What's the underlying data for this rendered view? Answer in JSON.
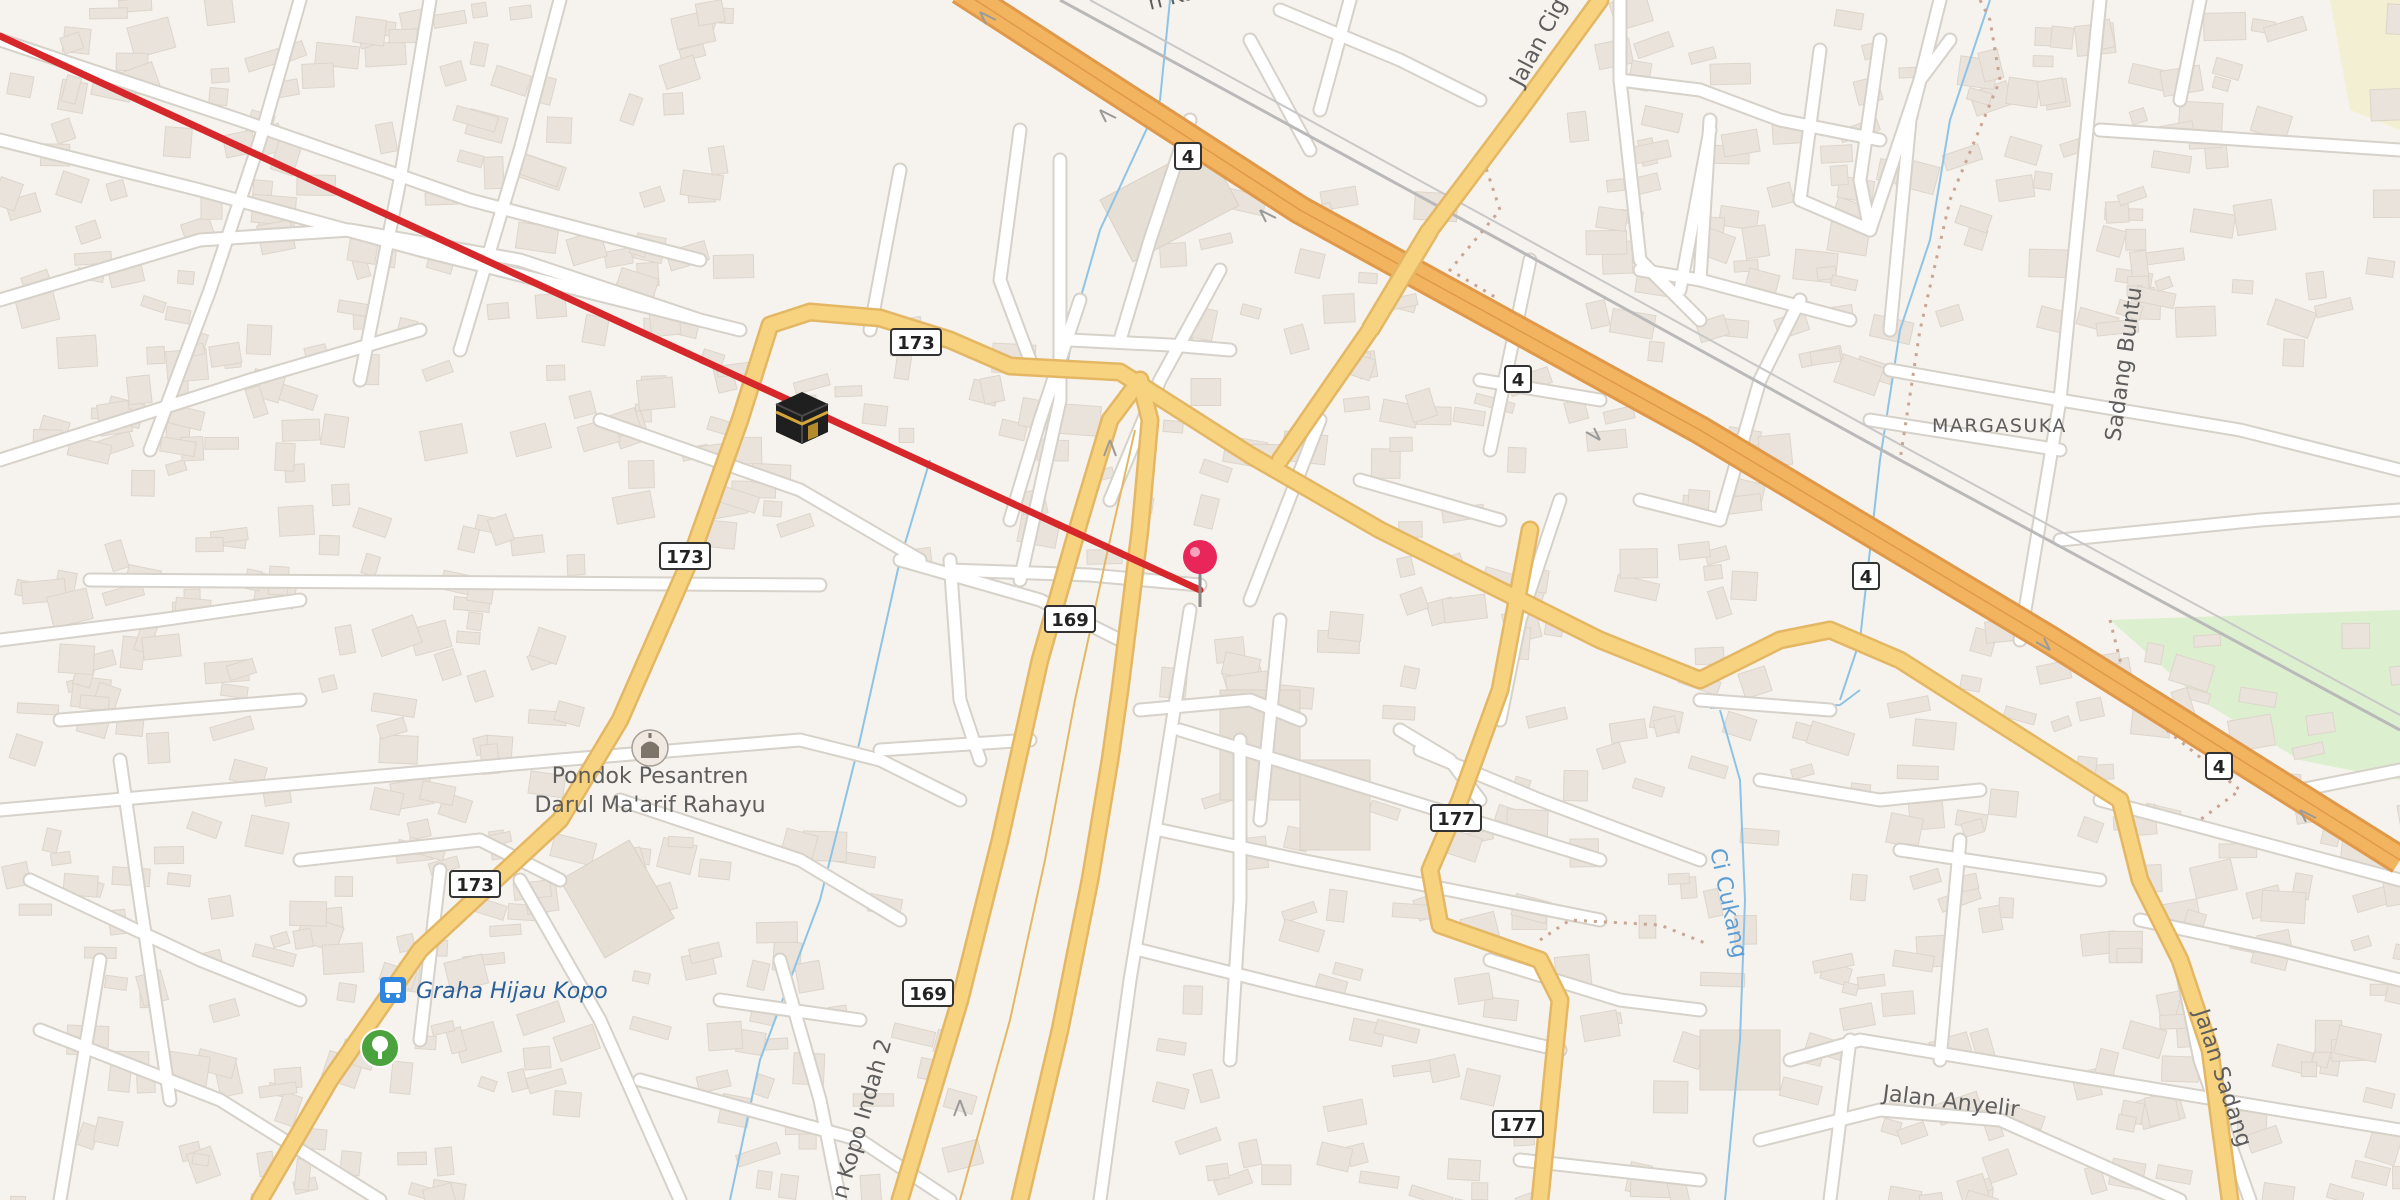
{
  "map": {
    "route_shields": [
      {
        "id": "s4a",
        "text": "4"
      },
      {
        "id": "s4b",
        "text": "4"
      },
      {
        "id": "s4c",
        "text": "4"
      },
      {
        "id": "s4d",
        "text": "4"
      },
      {
        "id": "s173a",
        "text": "173"
      },
      {
        "id": "s173b",
        "text": "173"
      },
      {
        "id": "s173c",
        "text": "173"
      },
      {
        "id": "s169a",
        "text": "169"
      },
      {
        "id": "s169b",
        "text": "169"
      },
      {
        "id": "s177a",
        "text": "177"
      },
      {
        "id": "s177b",
        "text": "177"
      }
    ],
    "street_labels": {
      "jalan_cig": "Jalan Cig",
      "kawinastri": "n Kawinastri",
      "sadang_buntu": "Sadang Buntu",
      "margasuka": "MARGASUKA",
      "kopo_indah": "n Kopo Indah 2",
      "cukang": "Ci Cukang",
      "jalan_anyelir": "Jalan Anyelir",
      "jalan_sadang": "Jalan Sadang"
    },
    "pois": {
      "pesantren_line1": "Pondok Pesantren",
      "pesantren_line2": "Darul Ma'arif Rahayu",
      "bus_stop": "Graha Hijau Kopo"
    },
    "icons": [
      "kaaba-icon",
      "map-pin-icon",
      "mosque-icon",
      "bus-stop-icon",
      "park-tree-icon"
    ],
    "colors": {
      "background": "#f6f3ee",
      "building": "#e9e3db",
      "minor_road": "#ffffff",
      "secondary_road": "#f8d37f",
      "motorway": "#f2b45e",
      "qibla_line": "#d6282b",
      "water": "#8ec3e6",
      "park": "#dcefcf",
      "pin": "#e8265a"
    }
  }
}
